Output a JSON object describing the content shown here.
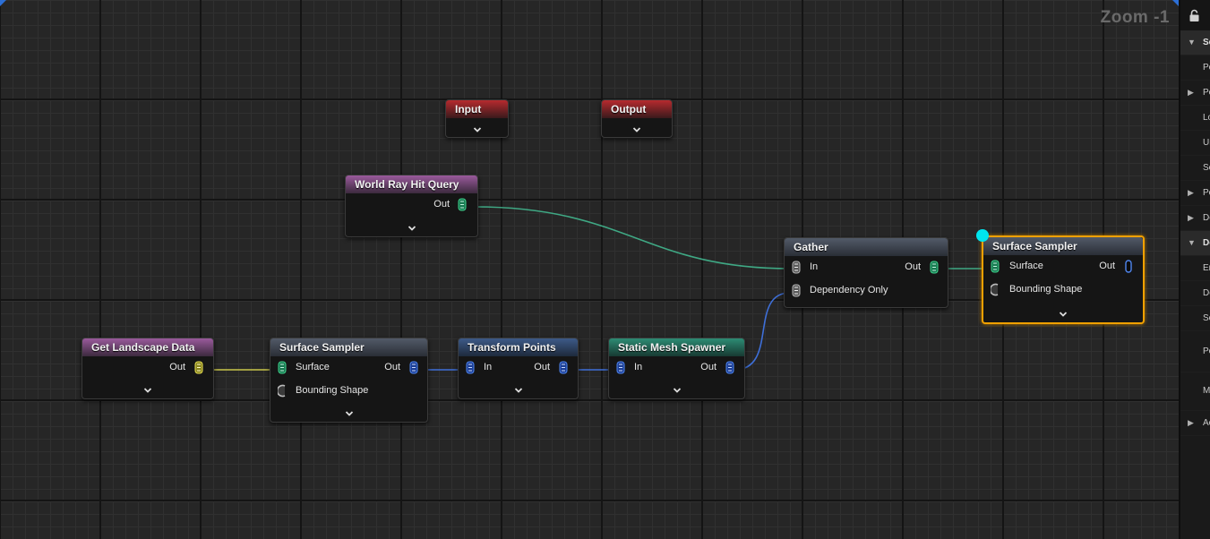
{
  "graph": {
    "zoom_label": "Zoom -1",
    "nodes": {
      "input": {
        "title": "Input"
      },
      "output": {
        "title": "Output"
      },
      "world_ray": {
        "title": "World Ray Hit Query",
        "out": "Out"
      },
      "get_landscape": {
        "title": "Get Landscape Data",
        "out": "Out"
      },
      "surface_sampler_1": {
        "title": "Surface Sampler",
        "in1": "Surface",
        "in2": "Bounding Shape",
        "out": "Out"
      },
      "transform_points": {
        "title": "Transform Points",
        "in": "In",
        "out": "Out"
      },
      "static_mesh_spawner": {
        "title": "Static Mesh Spawner",
        "in": "In",
        "out": "Out"
      },
      "gather": {
        "title": "Gather",
        "in": "In",
        "in2": "Dependency Only",
        "out": "Out"
      },
      "surface_sampler_2": {
        "title": "Surface Sampler",
        "in1": "Surface",
        "in2": "Bounding Shape",
        "out": "Out"
      }
    },
    "colors": {
      "wire_green": "#3fa884",
      "wire_yellow": "#c9c64a",
      "wire_blue": "#3e6fd8",
      "selection": "#f0a000",
      "accent_cyan": "#00e5ee"
    }
  },
  "details_panel": {
    "icons": [
      "lock-icon"
    ],
    "rows": [
      {
        "label": "Se",
        "kind": "category",
        "expanded": true
      },
      {
        "label": "Po",
        "kind": "property"
      },
      {
        "label": "Po",
        "kind": "subcategory",
        "expanded": false
      },
      {
        "label": "Lo",
        "kind": "property"
      },
      {
        "label": "Ur",
        "kind": "property"
      },
      {
        "label": "Se",
        "kind": "property"
      },
      {
        "label": "Po",
        "kind": "subcategory",
        "expanded": false
      },
      {
        "label": "De",
        "kind": "subcategory",
        "expanded": false
      },
      {
        "label": "De",
        "kind": "category",
        "expanded": true
      },
      {
        "label": "En",
        "kind": "property"
      },
      {
        "label": "De",
        "kind": "property"
      },
      {
        "label": "So",
        "kind": "property"
      },
      {
        "label": "Po",
        "kind": "property"
      },
      {
        "label": "M",
        "kind": "property"
      },
      {
        "label": "Ac",
        "kind": "subcategory",
        "expanded": false
      }
    ]
  }
}
